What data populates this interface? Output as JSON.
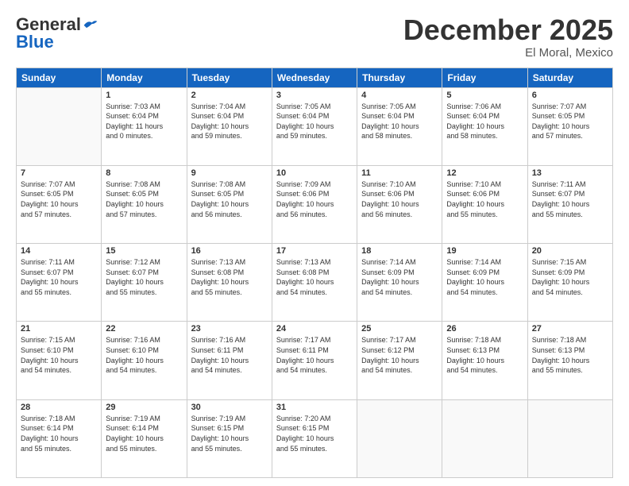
{
  "header": {
    "logo_general": "General",
    "logo_blue": "Blue",
    "month": "December 2025",
    "location": "El Moral, Mexico"
  },
  "weekdays": [
    "Sunday",
    "Monday",
    "Tuesday",
    "Wednesday",
    "Thursday",
    "Friday",
    "Saturday"
  ],
  "weeks": [
    [
      {
        "day": "",
        "info": ""
      },
      {
        "day": "1",
        "info": "Sunrise: 7:03 AM\nSunset: 6:04 PM\nDaylight: 11 hours\nand 0 minutes."
      },
      {
        "day": "2",
        "info": "Sunrise: 7:04 AM\nSunset: 6:04 PM\nDaylight: 10 hours\nand 59 minutes."
      },
      {
        "day": "3",
        "info": "Sunrise: 7:05 AM\nSunset: 6:04 PM\nDaylight: 10 hours\nand 59 minutes."
      },
      {
        "day": "4",
        "info": "Sunrise: 7:05 AM\nSunset: 6:04 PM\nDaylight: 10 hours\nand 58 minutes."
      },
      {
        "day": "5",
        "info": "Sunrise: 7:06 AM\nSunset: 6:04 PM\nDaylight: 10 hours\nand 58 minutes."
      },
      {
        "day": "6",
        "info": "Sunrise: 7:07 AM\nSunset: 6:05 PM\nDaylight: 10 hours\nand 57 minutes."
      }
    ],
    [
      {
        "day": "7",
        "info": "Sunrise: 7:07 AM\nSunset: 6:05 PM\nDaylight: 10 hours\nand 57 minutes."
      },
      {
        "day": "8",
        "info": "Sunrise: 7:08 AM\nSunset: 6:05 PM\nDaylight: 10 hours\nand 57 minutes."
      },
      {
        "day": "9",
        "info": "Sunrise: 7:08 AM\nSunset: 6:05 PM\nDaylight: 10 hours\nand 56 minutes."
      },
      {
        "day": "10",
        "info": "Sunrise: 7:09 AM\nSunset: 6:06 PM\nDaylight: 10 hours\nand 56 minutes."
      },
      {
        "day": "11",
        "info": "Sunrise: 7:10 AM\nSunset: 6:06 PM\nDaylight: 10 hours\nand 56 minutes."
      },
      {
        "day": "12",
        "info": "Sunrise: 7:10 AM\nSunset: 6:06 PM\nDaylight: 10 hours\nand 55 minutes."
      },
      {
        "day": "13",
        "info": "Sunrise: 7:11 AM\nSunset: 6:07 PM\nDaylight: 10 hours\nand 55 minutes."
      }
    ],
    [
      {
        "day": "14",
        "info": "Sunrise: 7:11 AM\nSunset: 6:07 PM\nDaylight: 10 hours\nand 55 minutes."
      },
      {
        "day": "15",
        "info": "Sunrise: 7:12 AM\nSunset: 6:07 PM\nDaylight: 10 hours\nand 55 minutes."
      },
      {
        "day": "16",
        "info": "Sunrise: 7:13 AM\nSunset: 6:08 PM\nDaylight: 10 hours\nand 55 minutes."
      },
      {
        "day": "17",
        "info": "Sunrise: 7:13 AM\nSunset: 6:08 PM\nDaylight: 10 hours\nand 54 minutes."
      },
      {
        "day": "18",
        "info": "Sunrise: 7:14 AM\nSunset: 6:09 PM\nDaylight: 10 hours\nand 54 minutes."
      },
      {
        "day": "19",
        "info": "Sunrise: 7:14 AM\nSunset: 6:09 PM\nDaylight: 10 hours\nand 54 minutes."
      },
      {
        "day": "20",
        "info": "Sunrise: 7:15 AM\nSunset: 6:09 PM\nDaylight: 10 hours\nand 54 minutes."
      }
    ],
    [
      {
        "day": "21",
        "info": "Sunrise: 7:15 AM\nSunset: 6:10 PM\nDaylight: 10 hours\nand 54 minutes."
      },
      {
        "day": "22",
        "info": "Sunrise: 7:16 AM\nSunset: 6:10 PM\nDaylight: 10 hours\nand 54 minutes."
      },
      {
        "day": "23",
        "info": "Sunrise: 7:16 AM\nSunset: 6:11 PM\nDaylight: 10 hours\nand 54 minutes."
      },
      {
        "day": "24",
        "info": "Sunrise: 7:17 AM\nSunset: 6:11 PM\nDaylight: 10 hours\nand 54 minutes."
      },
      {
        "day": "25",
        "info": "Sunrise: 7:17 AM\nSunset: 6:12 PM\nDaylight: 10 hours\nand 54 minutes."
      },
      {
        "day": "26",
        "info": "Sunrise: 7:18 AM\nSunset: 6:13 PM\nDaylight: 10 hours\nand 54 minutes."
      },
      {
        "day": "27",
        "info": "Sunrise: 7:18 AM\nSunset: 6:13 PM\nDaylight: 10 hours\nand 55 minutes."
      }
    ],
    [
      {
        "day": "28",
        "info": "Sunrise: 7:18 AM\nSunset: 6:14 PM\nDaylight: 10 hours\nand 55 minutes."
      },
      {
        "day": "29",
        "info": "Sunrise: 7:19 AM\nSunset: 6:14 PM\nDaylight: 10 hours\nand 55 minutes."
      },
      {
        "day": "30",
        "info": "Sunrise: 7:19 AM\nSunset: 6:15 PM\nDaylight: 10 hours\nand 55 minutes."
      },
      {
        "day": "31",
        "info": "Sunrise: 7:20 AM\nSunset: 6:15 PM\nDaylight: 10 hours\nand 55 minutes."
      },
      {
        "day": "",
        "info": ""
      },
      {
        "day": "",
        "info": ""
      },
      {
        "day": "",
        "info": ""
      }
    ]
  ]
}
